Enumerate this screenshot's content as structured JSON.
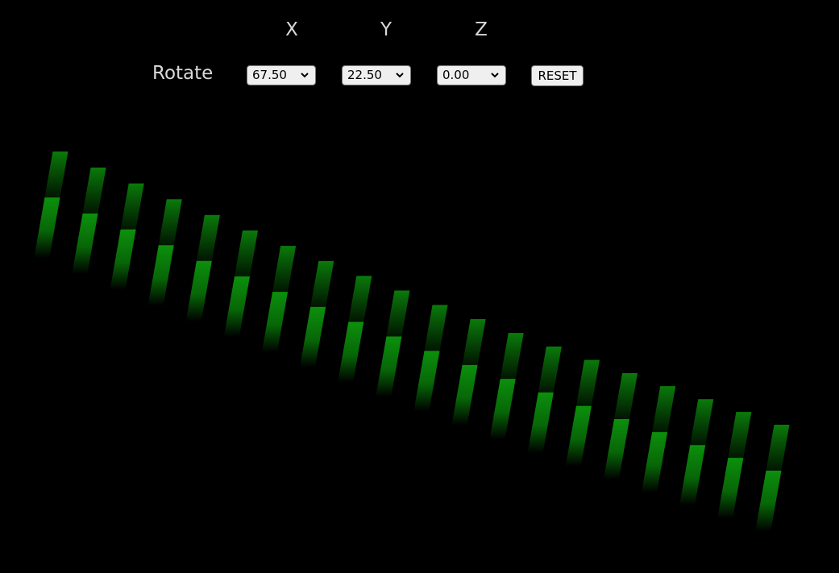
{
  "axes": {
    "x_label": "X",
    "y_label": "Y",
    "z_label": "Z"
  },
  "rotate_label": "Rotate",
  "selects": {
    "x_value": "67.50",
    "y_value": "22.50",
    "z_value": "0.00"
  },
  "reset_label": "RESET",
  "colors": {
    "background": "#000000",
    "bar_bright": "#0b8a0b",
    "bar_dark": "#063d06",
    "label": "#d9d9d9"
  },
  "bars": {
    "count": 20
  }
}
